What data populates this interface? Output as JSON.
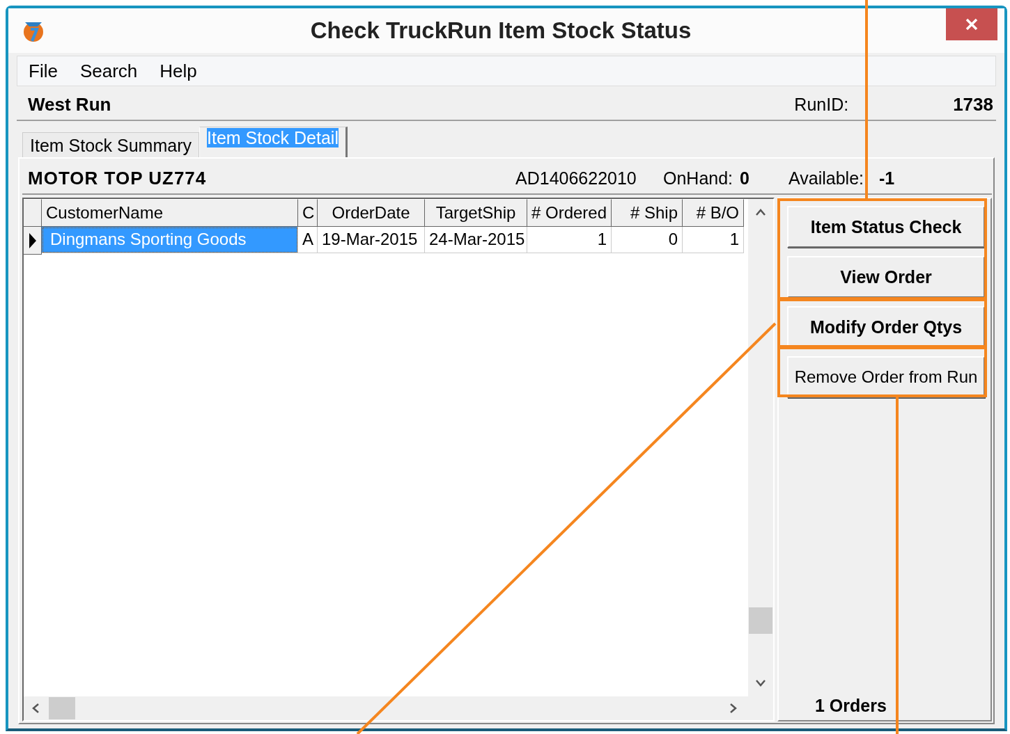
{
  "window": {
    "title": "Check TruckRun Item Stock Status"
  },
  "menu": [
    {
      "label": "File"
    },
    {
      "label": "Search"
    },
    {
      "label": "Help"
    }
  ],
  "run": {
    "name": "West Run",
    "id_label": "RunID:",
    "id": "1738"
  },
  "tabs": [
    {
      "label": "Item Stock Summary",
      "selected": false
    },
    {
      "label": "Item Stock Detail",
      "selected": true
    }
  ],
  "item": {
    "name": "MOTOR TOP UZ774",
    "code": "AD1406622010",
    "onhand_label": "OnHand:",
    "onhand": "0",
    "available_label": "Available:",
    "available": "-1"
  },
  "table": {
    "columns": [
      "CustomerName",
      "C",
      "OrderDate",
      "TargetShip",
      "# Ordered",
      "# Ship",
      "# B/O"
    ],
    "rows": [
      {
        "cells": [
          "Dingmans Sporting Goods",
          "A",
          "19-Mar-2015",
          "24-Mar-2015",
          "1",
          "0",
          "1"
        ],
        "selected": true
      }
    ]
  },
  "buttons": [
    {
      "label": "Item Status Check",
      "bold": true
    },
    {
      "label": "View Order",
      "bold": true
    },
    {
      "label": "Modify Order Qtys",
      "bold": true
    },
    {
      "label": "Remove Order from Run",
      "bold": false
    }
  ],
  "status": "1 Orders"
}
